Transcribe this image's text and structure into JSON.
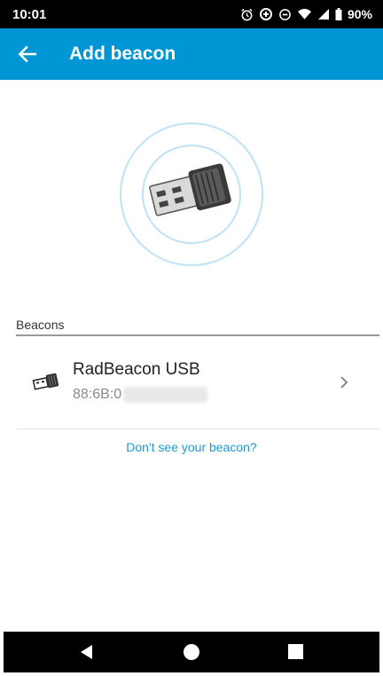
{
  "status_bar": {
    "time": "10:01",
    "battery": "90%",
    "icons": [
      "alarm-icon",
      "data-saver-icon",
      "do-not-disturb-icon",
      "wifi-icon",
      "signal-icon",
      "battery-icon"
    ]
  },
  "app_bar": {
    "back_icon": "back-arrow-icon",
    "title": "Add beacon",
    "color": "#0096d6"
  },
  "section": {
    "label": "Beacons"
  },
  "beacons": [
    {
      "name": "RadBeacon USB",
      "address": "88:6B:0",
      "icon": "usb-beacon-icon",
      "chevron": "chevron-right-icon"
    }
  ],
  "help_link": {
    "label": "Don't see your beacon?",
    "color": "#1a9ad6"
  },
  "nav_bar": {
    "icons": [
      "nav-back-icon",
      "nav-home-icon",
      "nav-recents-icon"
    ]
  }
}
